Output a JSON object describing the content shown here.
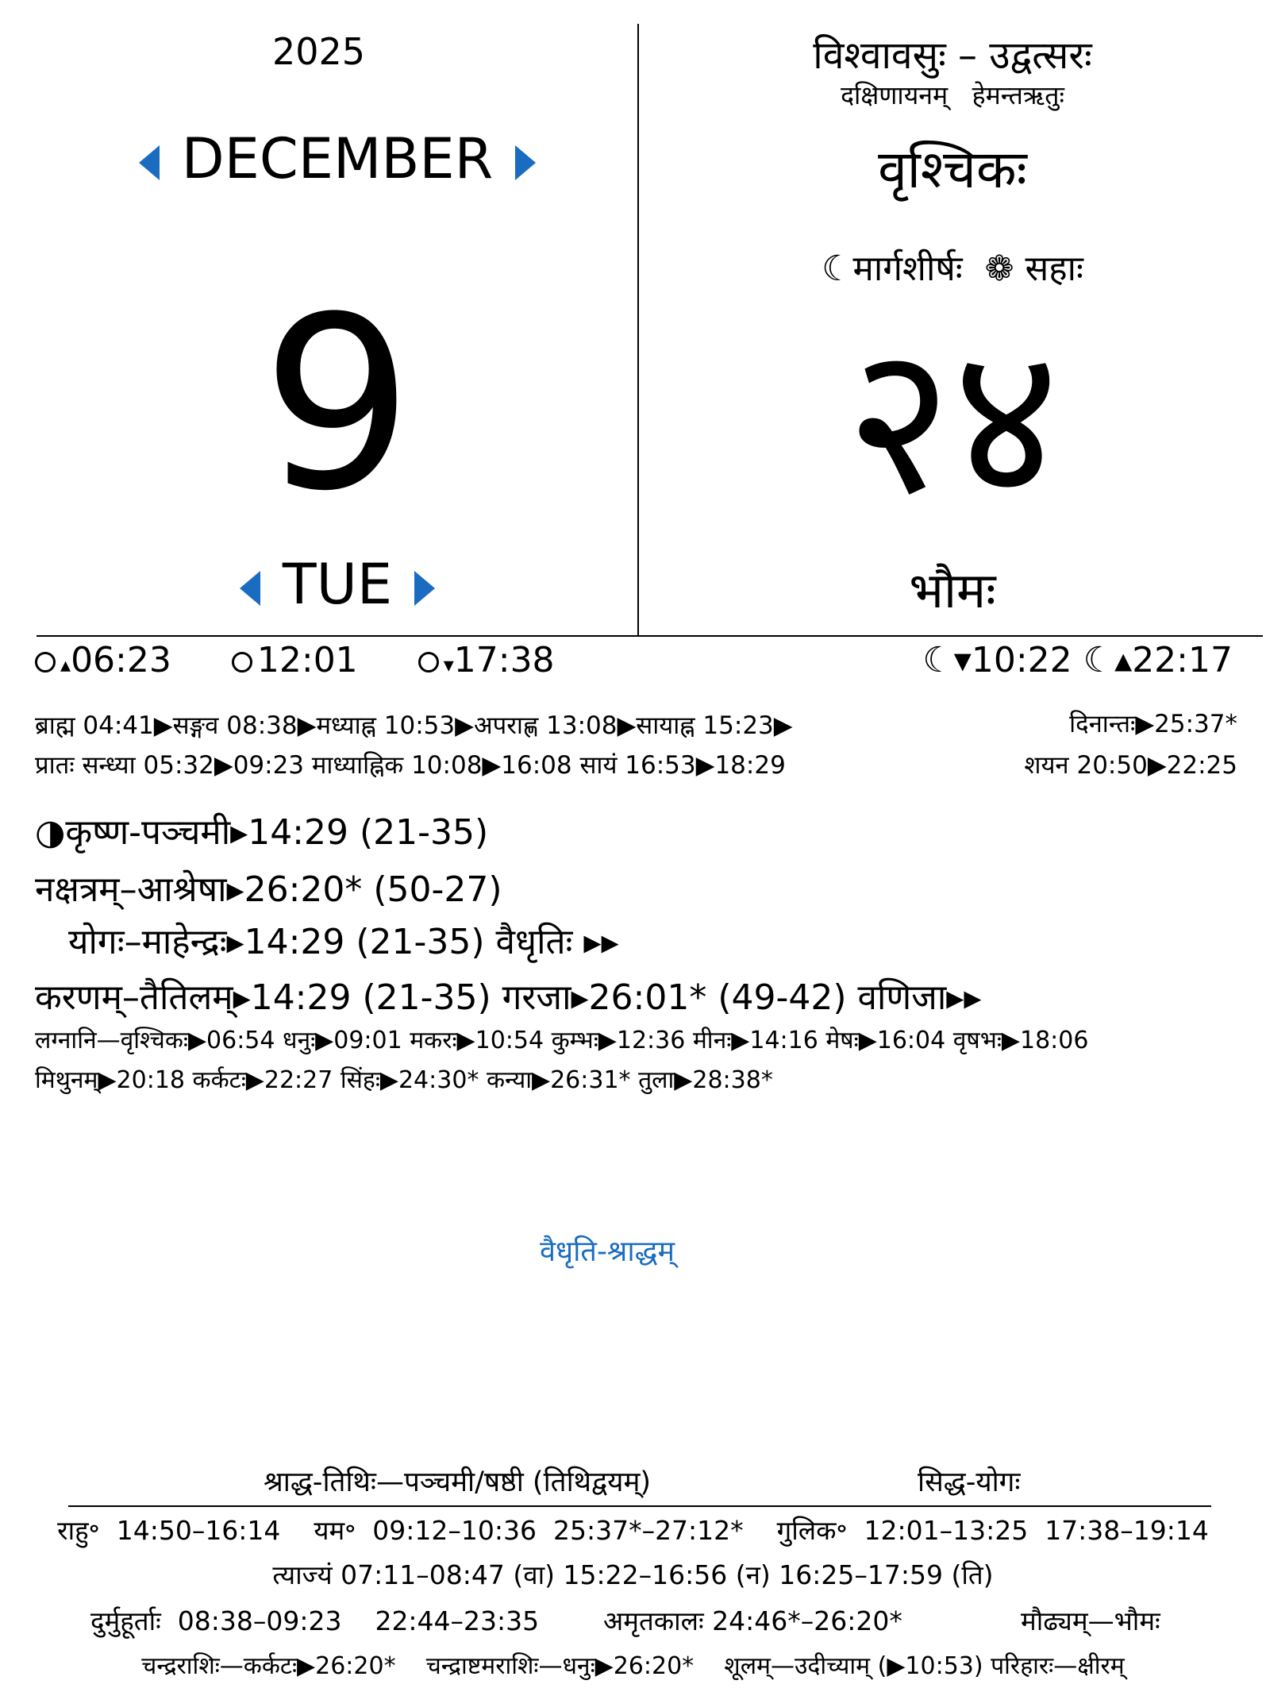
{
  "header": {
    "year": "2025",
    "month": "DECEMBER",
    "day_number": "9",
    "weekday": "TUE",
    "samvatsara": "विश्वावसुः – उद्वत्सरः",
    "ayana_ritu": "दक्षिणायनम्   हेमन्तऋतुः",
    "rashi": "वृश्चिकः",
    "lunar_month": "☾मार्गशीर्षः",
    "solar_month": "❁ सहाः",
    "indic_day": "२४",
    "vara": "भौमः"
  },
  "sun_moon": {
    "sunrise": "06:23",
    "noon": "12:01",
    "sunset": "17:38",
    "moonset": "☾▾10:22",
    "moonrise": "☾▴22:17"
  },
  "muhurta_line1": "ब्राह्म 04:41▶सङ्गव 08:38▶मध्याह्न 10:53▶अपराह्ण 13:08▶सायाह्न 15:23▶",
  "muhurta_line1_right": "दिनान्तः▶25:37*",
  "muhurta_line2": "प्रातः सन्ध्या 05:32▶09:23 माध्याह्निक 10:08▶16:08 सायं 16:53▶18:29",
  "muhurta_line2_right": "शयन 20:50▶22:25",
  "tithi": "◑कृष्ण-पञ्चमी▸14:29 (21-35)",
  "nakshatra": "नक्षत्रम्–आश्रेषा▸26:20* (50-27)",
  "yoga": "योगः–माहेन्द्रः▸14:29 (21-35)  वैधृतिः ▸▸",
  "karana": "करणम्–तैतिलम्▸14:29 (21-35)  गरजा▸26:01* (49-42)  वणिजा▸▸",
  "lagna_line1": "लग्नानि—वृश्चिकः▶06:54  धनुः▶09:01  मकरः▶10:54  कुम्भः▶12:36  मीनः▶14:16  मेषः▶16:04  वृषभः▶18:06",
  "lagna_line2": "मिथुनम्▶20:18  कर्कटः▶22:27  सिंहः▶24:30*  कन्या▶26:31*  तुला▶28:38*",
  "festival": "वैधृति-श्राद्धम्",
  "shraddha_tithi": "श्राद्ध-तिथिः—पञ्चमी/षष्ठी  (तिथिद्वयम्)",
  "siddha_yoga": "सिद्ध-योगः",
  "footer": {
    "rahu_line": "राहु॰  14:50–16:14    यम॰  09:12–10:36  25:37*–27:12*    गुलिक॰  12:01–13:25  17:38–19:14",
    "tyajya_line": "त्याज्यं  07:11–08:47 (वा) 15:22–16:56 (न) 16:25–17:59 (ति)",
    "durmuhurta_left": "दुर्मुहूर्ताः  08:38–09:23    22:44–23:35",
    "amrita": "अमृतकालः  24:46*–26:20*",
    "maudhya": "मौढ्यम्—भौमः",
    "chandra_line": "चन्द्रराशिः—कर्कटः▶26:20*    चन्द्राष्टमराशिः—धनुः▶26:20*    शूलम्—उदीच्याम् (▶10:53) परिहारः—क्षीरम्"
  }
}
